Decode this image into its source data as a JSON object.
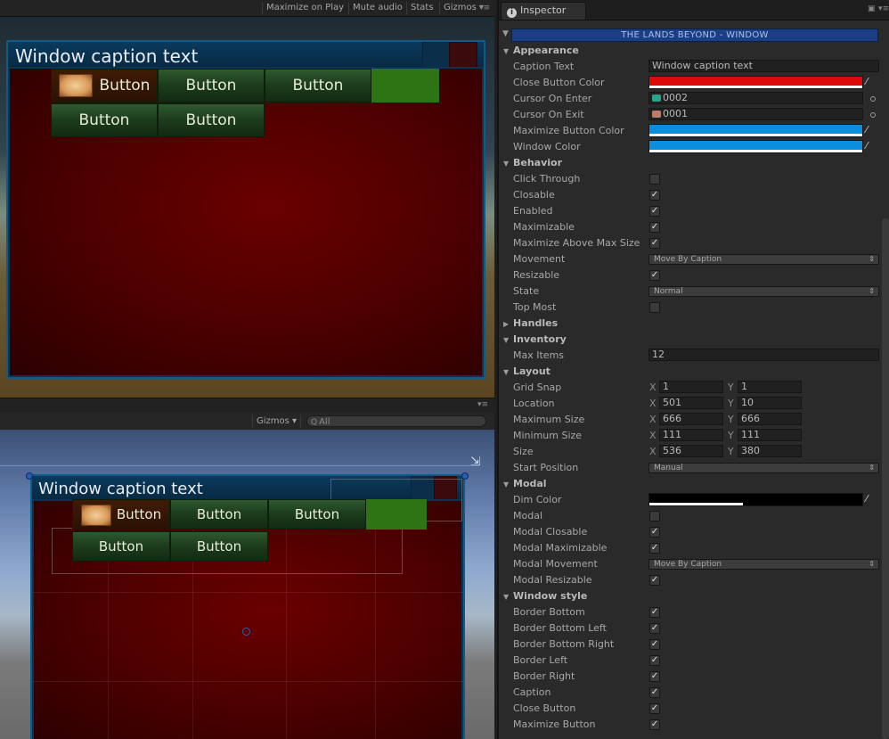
{
  "game_toolbar": {
    "maximize_on_play": "Maximize on Play",
    "mute_audio": "Mute audio",
    "stats": "Stats",
    "gizmos": "Gizmos"
  },
  "game_window": {
    "caption": "Window caption text",
    "buttons_row1": [
      "Button",
      "Button",
      "Button"
    ],
    "buttons_row2": [
      "Button",
      "Button"
    ]
  },
  "scene_toolbar": {
    "gizmos": "Gizmos",
    "search_placeholder": "All"
  },
  "scene_window": {
    "caption": "Window caption text",
    "buttons_row1": [
      "Button",
      "Button",
      "Button"
    ],
    "buttons_row2": [
      "Button",
      "Button"
    ]
  },
  "inspector": {
    "tab": "Inspector",
    "component_title": "THE LANDS BEYOND - WINDOW",
    "sections": {
      "appearance": {
        "title": "Appearance",
        "caption_text": {
          "label": "Caption Text",
          "value": "Window caption text"
        },
        "close_button_color": {
          "label": "Close Button Color",
          "color": "#dd0a0a"
        },
        "cursor_on_enter": {
          "label": "Cursor On Enter",
          "value": "0002"
        },
        "cursor_on_exit": {
          "label": "Cursor On Exit",
          "value": "0001"
        },
        "maximize_button_color": {
          "label": "Maximize Button Color",
          "color": "#0a8fe0"
        },
        "window_color": {
          "label": "Window Color",
          "color": "#0a8fe0"
        }
      },
      "behavior": {
        "title": "Behavior",
        "click_through": {
          "label": "Click Through",
          "checked": false
        },
        "closable": {
          "label": "Closable",
          "checked": true
        },
        "enabled": {
          "label": "Enabled",
          "checked": true
        },
        "maximizable": {
          "label": "Maximizable",
          "checked": true
        },
        "maximize_above_max_size": {
          "label": "Maximize Above Max Size",
          "checked": true
        },
        "movement": {
          "label": "Movement",
          "value": "Move By Caption"
        },
        "resizable": {
          "label": "Resizable",
          "checked": true
        },
        "state": {
          "label": "State",
          "value": "Normal"
        },
        "top_most": {
          "label": "Top Most",
          "checked": false
        }
      },
      "handles": {
        "title": "Handles"
      },
      "inventory": {
        "title": "Inventory",
        "max_items": {
          "label": "Max Items",
          "value": "12"
        }
      },
      "layout": {
        "title": "Layout",
        "x_label": "X",
        "y_label": "Y",
        "grid_snap": {
          "label": "Grid Snap",
          "x": "1",
          "y": "1"
        },
        "location": {
          "label": "Location",
          "x": "501",
          "y": "10"
        },
        "maximum_size": {
          "label": "Maximum Size",
          "x": "666",
          "y": "666"
        },
        "minimum_size": {
          "label": "Minimum Size",
          "x": "111",
          "y": "111"
        },
        "size": {
          "label": "Size",
          "x": "536",
          "y": "380"
        },
        "start_position": {
          "label": "Start Position",
          "value": "Manual"
        }
      },
      "modal": {
        "title": "Modal",
        "dim_color": {
          "label": "Dim Color",
          "color": "#000000",
          "alpha": 0.44
        },
        "modal": {
          "label": "Modal",
          "checked": false
        },
        "modal_closable": {
          "label": "Modal Closable",
          "checked": true
        },
        "modal_maximizable": {
          "label": "Modal Maximizable",
          "checked": true
        },
        "modal_movement": {
          "label": "Modal Movement",
          "value": "Move By Caption"
        },
        "modal_resizable": {
          "label": "Modal Resizable",
          "checked": true
        }
      },
      "window_style": {
        "title": "Window style",
        "border_bottom": {
          "label": "Border Bottom",
          "checked": true
        },
        "border_bottom_left": {
          "label": "Border Bottom Left",
          "checked": true
        },
        "border_bottom_right": {
          "label": "Border Bottom Right",
          "checked": true
        },
        "border_left": {
          "label": "Border Left",
          "checked": true
        },
        "border_right": {
          "label": "Border Right",
          "checked": true
        },
        "caption": {
          "label": "Caption",
          "checked": true
        },
        "close_button": {
          "label": "Close Button",
          "checked": true
        },
        "maximize_button": {
          "label": "Maximize Button",
          "checked": true
        }
      }
    }
  },
  "icons": {
    "menu": "▾≡",
    "lock": "🔒",
    "info": "i",
    "foldout_open": "▼",
    "foldout_closed": "▶",
    "check": "✓",
    "picker": "⁄",
    "dropdown_arrow": "⇕",
    "search": "Q"
  }
}
